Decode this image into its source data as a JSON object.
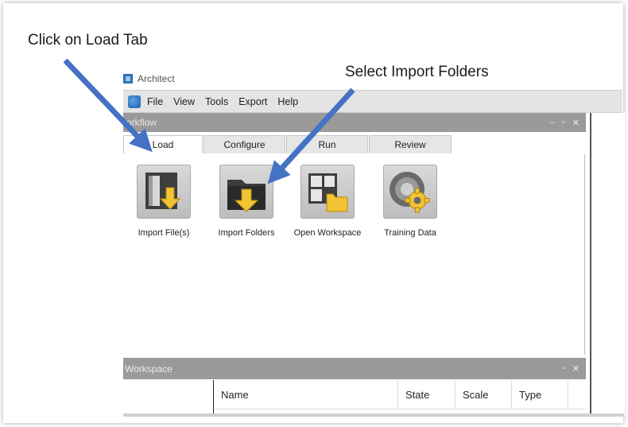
{
  "annotations": {
    "load_tab": "Click on Load Tab",
    "import_folders": "Select Import Folders"
  },
  "app": {
    "title": "Architect"
  },
  "menu": {
    "items": [
      "File",
      "View",
      "Tools",
      "Export",
      "Help"
    ]
  },
  "workflow": {
    "title": "orkflow",
    "controls": [
      "–",
      "▫",
      "✕"
    ],
    "tabs": [
      "Load",
      "Configure",
      "Run",
      "Review"
    ],
    "active_tab": "Load",
    "tools": [
      {
        "label": "Import File(s)",
        "icon": "import-file-icon"
      },
      {
        "label": "Import Folders",
        "icon": "import-folder-icon"
      },
      {
        "label": "Open Workspace",
        "icon": "open-workspace-icon"
      },
      {
        "label": "Training Data",
        "icon": "training-data-icon"
      }
    ]
  },
  "workspace": {
    "title": "Workspace",
    "controls": [
      "▫",
      "✕"
    ],
    "columns": [
      "Name",
      "State",
      "Scale",
      "Type"
    ]
  },
  "colors": {
    "arrow": "#4472c4",
    "header": "#9a9a9a",
    "folder_yellow": "#f2c433"
  }
}
